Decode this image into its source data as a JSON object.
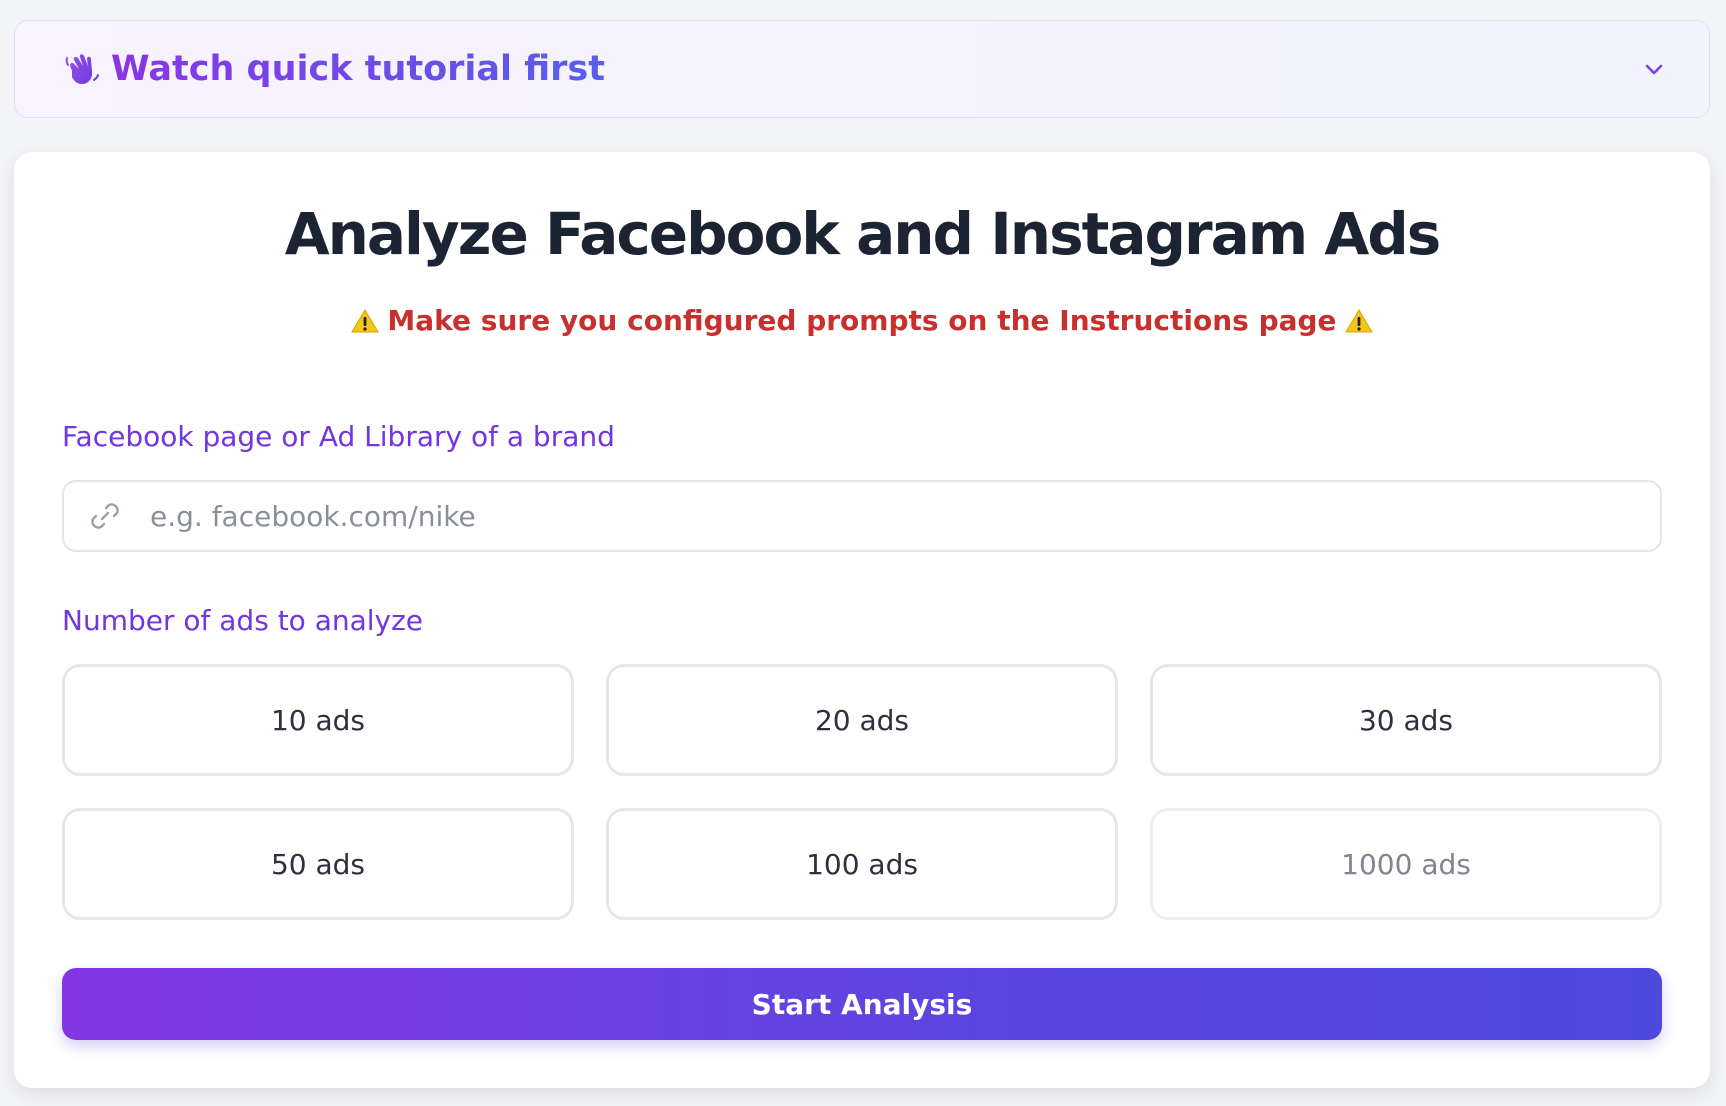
{
  "tutorial": {
    "title": "Watch quick tutorial first",
    "icon": "waving-hand-icon",
    "toggle_icon": "chevron-down-icon"
  },
  "main": {
    "title": "Analyze Facebook and Instagram Ads",
    "warning": "Make sure you configured prompts on the Instructions page",
    "warning_icon": "warning-icon"
  },
  "form": {
    "page_label": "Facebook page or Ad Library of a brand",
    "page_placeholder": "e.g. facebook.com/nike",
    "page_value": "",
    "count_label": "Number of ads to analyze",
    "count_options": [
      "10 ads",
      "20 ads",
      "30 ads",
      "50 ads",
      "100 ads",
      "1000 ads"
    ],
    "submit_label": "Start Analysis"
  },
  "colors": {
    "accent_purple": "#7136e0",
    "warning_red": "#c7302c",
    "button_gradient_start": "#8337e3",
    "button_gradient_end": "#4e49dd",
    "title_dark": "#1c2333"
  }
}
